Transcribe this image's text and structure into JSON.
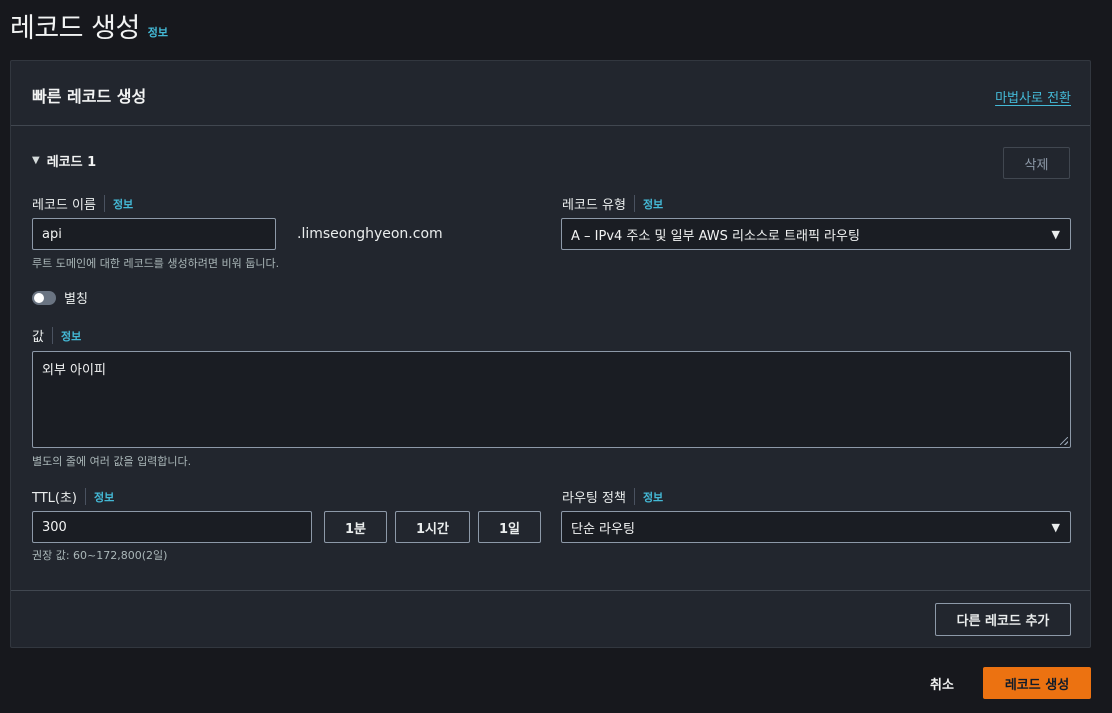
{
  "page": {
    "title": "레코드 생성",
    "info": "정보"
  },
  "panel": {
    "title": "빠른 레코드 생성",
    "wizard_link": "마법사로 전환",
    "record_toggle": "레코드 1",
    "delete_button": "삭제",
    "record_name": {
      "label": "레코드 이름",
      "info": "정보",
      "value": "api",
      "suffix": ".limseonghyeon.com",
      "hint": "루트 도메인에 대한 레코드를 생성하려면 비워 둡니다."
    },
    "record_type": {
      "label": "레코드 유형",
      "info": "정보",
      "selected": "A – IPv4 주소 및 일부 AWS 리소스로 트래픽 라우팅"
    },
    "alias": {
      "label": "별칭",
      "enabled": false
    },
    "value": {
      "label": "값",
      "info": "정보",
      "content": "외부 아이피",
      "hint": "별도의 줄에 여러 값을 입력합니다."
    },
    "ttl": {
      "label": "TTL(초)",
      "info": "정보",
      "value": "300",
      "presets": [
        "1분",
        "1시간",
        "1일"
      ],
      "hint": "권장 값: 60~172,800(2일)"
    },
    "routing_policy": {
      "label": "라우팅 정책",
      "info": "정보",
      "selected": "단순 라우팅"
    },
    "add_record_button": "다른 레코드 추가"
  },
  "footer": {
    "cancel": "취소",
    "submit": "레코드 생성"
  },
  "colors": {
    "accent": "#ec7211",
    "link": "#44b9d6",
    "background": "#17181d",
    "panel": "#22262e"
  },
  "icons": {
    "caret": "triangle-down-icon",
    "select_arrow": "triangle-down-icon"
  }
}
